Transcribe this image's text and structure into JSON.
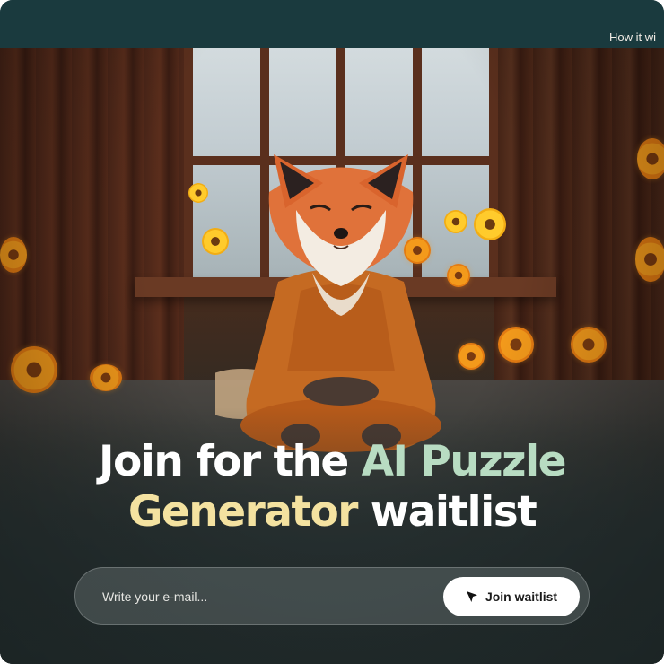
{
  "nav": {
    "how_it_works": "How it wi"
  },
  "headline": {
    "line1_white": "Join for the ",
    "line1_green": "AI Puzzle",
    "line2_yellow": "Generator",
    "line2_white": " waitlist"
  },
  "form": {
    "email_placeholder": "Write your e-mail...",
    "submit_label": "Join waitlist",
    "submit_icon": "send-icon"
  },
  "colors": {
    "topbar": "#1a3a3e",
    "accent_green": "#b8dcc2",
    "accent_yellow": "#f4e2a0",
    "button_bg": "#ffffff"
  }
}
